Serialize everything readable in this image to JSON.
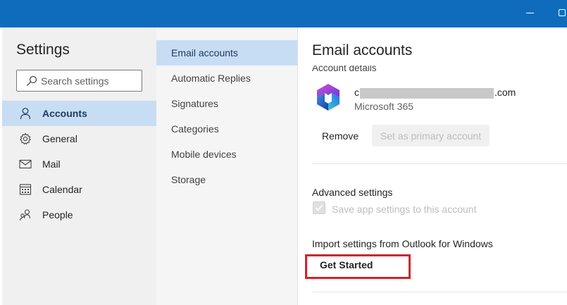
{
  "colors": {
    "titlebar": "#0f6cbd",
    "nav_active": "#c7ddf3",
    "highlight_box": "#d92027"
  },
  "sidebar": {
    "title": "Settings",
    "search_placeholder": "Search settings",
    "items": [
      {
        "label": "Accounts",
        "icon": "person-icon",
        "active": true
      },
      {
        "label": "General",
        "icon": "gear-icon",
        "active": false
      },
      {
        "label": "Mail",
        "icon": "mail-icon",
        "active": false
      },
      {
        "label": "Calendar",
        "icon": "calendar-icon",
        "active": false
      },
      {
        "label": "People",
        "icon": "people-icon",
        "active": false
      }
    ]
  },
  "subnav": {
    "items": [
      {
        "label": "Email accounts",
        "active": true
      },
      {
        "label": "Automatic Replies",
        "active": false
      },
      {
        "label": "Signatures",
        "active": false
      },
      {
        "label": "Categories",
        "active": false
      },
      {
        "label": "Mobile devices",
        "active": false
      },
      {
        "label": "Storage",
        "active": false
      }
    ]
  },
  "content": {
    "title": "Email accounts",
    "account_details_heading": "Account details",
    "account": {
      "email_start": "c",
      "email_end": ".com",
      "provider": "Microsoft 365",
      "logo_icon": "microsoft-365-logo-icon"
    },
    "remove_label": "Remove",
    "primary_label": "Set as primary account",
    "advanced_title": "Advanced settings",
    "save_settings_label": "Save app settings to this account",
    "import_title": "Import settings from Outlook for Windows",
    "get_started_label": "Get Started"
  }
}
